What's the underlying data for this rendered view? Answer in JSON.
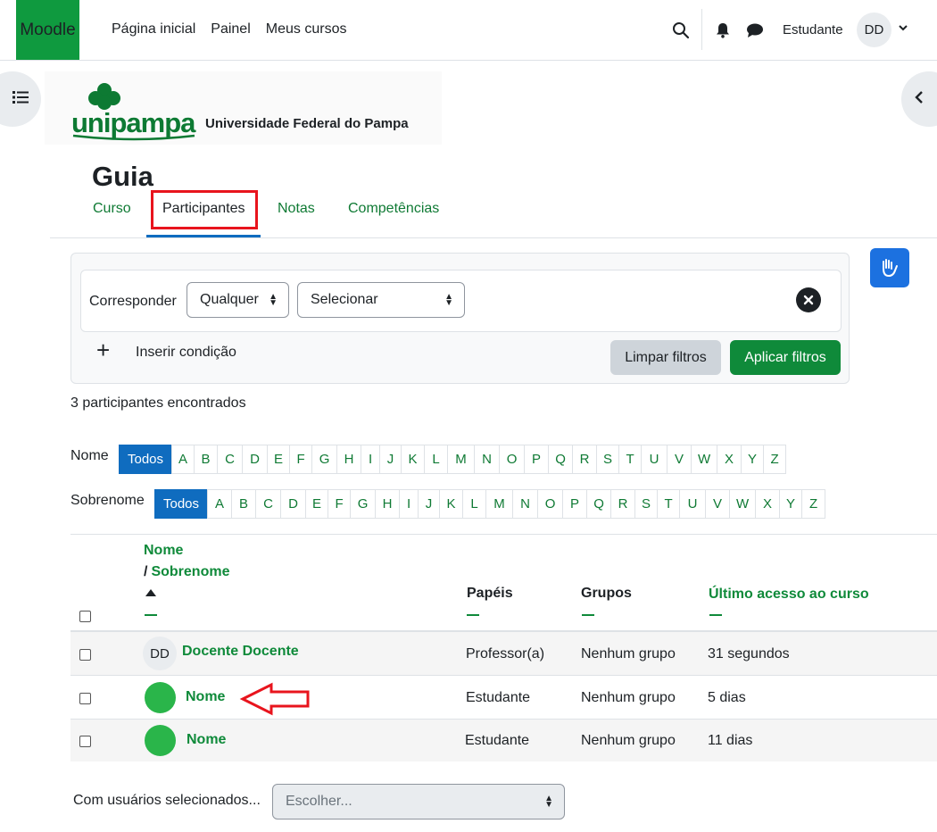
{
  "navbar": {
    "brand": "Moodle",
    "links": [
      "Página inicial",
      "Painel",
      "Meus cursos"
    ],
    "user_name": "Estudante",
    "avatar_initials": "DD"
  },
  "logo": {
    "name": "unipampa",
    "subtitle": "Universidade Federal do Pampa"
  },
  "course": {
    "title": "Guia",
    "tabs": [
      "Curso",
      "Participantes",
      "Notas",
      "Competências"
    ],
    "active_tab": "Participantes"
  },
  "filter": {
    "match_label": "Corresponder",
    "match_value": "Qualquer",
    "type_value": "Selecionar",
    "add_condition": "Inserir condição",
    "clear_button": "Limpar filtros",
    "apply_button": "Aplicar filtros"
  },
  "count_text": "3 participantes encontrados",
  "initials": {
    "first_label": "Nome",
    "last_label": "Sobrenome",
    "all": "Todos",
    "letters": [
      "A",
      "B",
      "C",
      "D",
      "E",
      "F",
      "G",
      "H",
      "I",
      "J",
      "K",
      "L",
      "M",
      "N",
      "O",
      "P",
      "Q",
      "R",
      "S",
      "T",
      "U",
      "V",
      "W",
      "X",
      "Y",
      "Z"
    ]
  },
  "table": {
    "headers": {
      "first": "Nome",
      "sep_last": "/",
      "last": "Sobrenome",
      "roles": "Papéis",
      "groups": "Grupos",
      "last_access": "Último acesso ao curso"
    },
    "rows": [
      {
        "avatar": "DD",
        "name": "Docente Docente",
        "role": "Professor(a)",
        "group": "Nenhum grupo",
        "access": "31 segundos"
      },
      {
        "avatar": "",
        "name": "Nome",
        "role": "Estudante",
        "group": "Nenhum grupo",
        "access": "5 dias"
      },
      {
        "avatar": "",
        "name": "Nome",
        "role": "Estudante",
        "group": "Nenhum grupo",
        "access": "11 dias"
      }
    ]
  },
  "bulk": {
    "label": "Com usuários selecionados...",
    "placeholder": "Escolher..."
  },
  "colors": {
    "brand": "#0f9a3f",
    "link": "#0f8a3a",
    "primary": "#0f6cbf",
    "highlight": "#e8141d"
  }
}
